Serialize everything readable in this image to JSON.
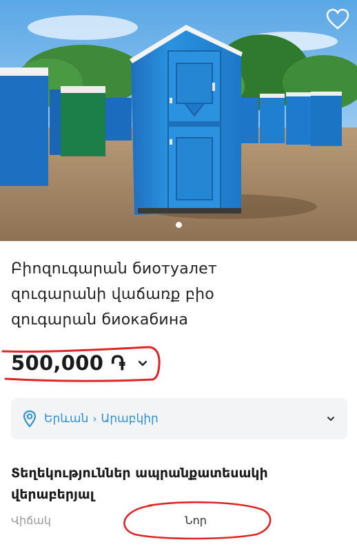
{
  "listing": {
    "title_lines": [
      "Բիոզուգարան биотуалет",
      "զուգարանի վաճառք բիօ",
      "զուգարան биокабина"
    ],
    "price": "500,000 ֏",
    "image_index": 1,
    "image_count": 1
  },
  "location": {
    "city": "Երևան",
    "district": "Արաբկիր"
  },
  "details": {
    "section_title_lines": [
      "Տեղեկություններ ապրանքատեսակի",
      "վերաբերյալ"
    ],
    "condition_label": "Վիճակ",
    "condition_value": "Նոր"
  },
  "colors": {
    "accent_link": "#2f8fd8",
    "annotation_red": "#e02424",
    "box_bg": "#f3f4f6"
  },
  "icons": {
    "favorite": "heart-icon",
    "location": "location-pin-icon",
    "price_expand": "chevron-down-icon",
    "location_expand": "chevron-down-icon"
  }
}
